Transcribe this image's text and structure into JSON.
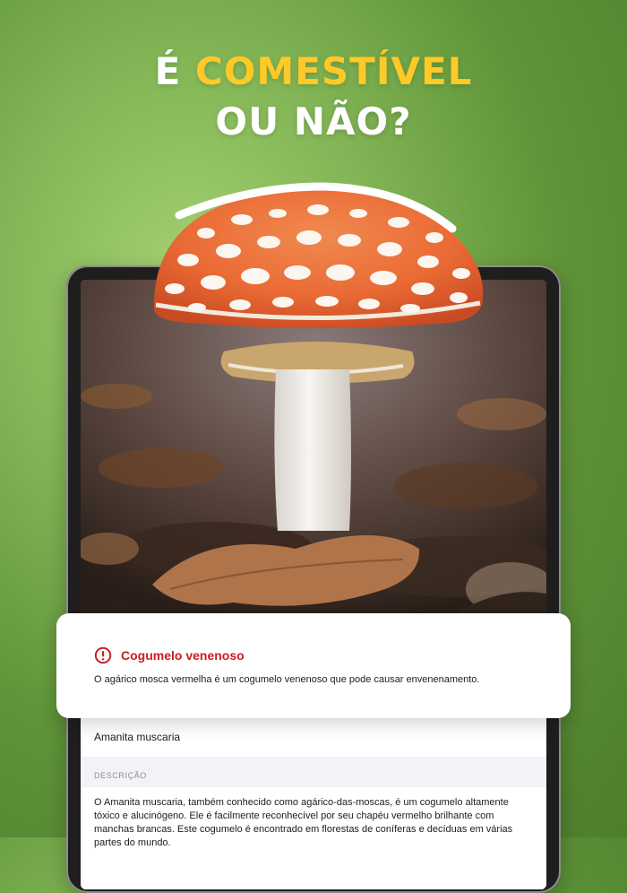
{
  "headline": {
    "prefix": "É ",
    "accent": "COMESTÍVEL",
    "line2": "OU NÃO?"
  },
  "colors": {
    "accent": "#ffc928",
    "alert_red": "#c81e1e",
    "background_green": "#83b656"
  },
  "alert": {
    "icon": "exclamation-circle-icon",
    "title": "Cogumelo venenoso",
    "text": "O agárico mosca vermelha é um cogumelo venenoso que pode causar envenenamento."
  },
  "details": {
    "scientific_name": "Amanita muscaria",
    "description_label": "DESCRIÇÃO",
    "description": "O Amanita muscaria, também conhecido como agárico-das-moscas, é um cogumelo altamente tóxico e alucinógeno. Ele é facilmente reconhecível por seu chapéu vermelho brilhante com manchas brancas. Este cogumelo é encontrado em florestas de coníferas e decíduas em várias partes do mundo."
  }
}
